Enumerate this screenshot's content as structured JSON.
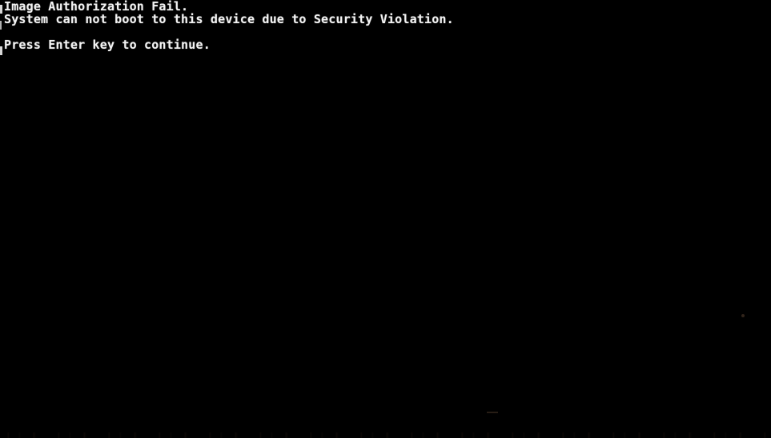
{
  "screen": {
    "background_color": "#000000",
    "text_color": "#f2f2f2",
    "mode": "text-console"
  },
  "console": {
    "lines": [
      {
        "text": "Image Authorization Fail."
      },
      {
        "text": "System can not boot to this device due to Security Violation."
      },
      {
        "text": ""
      },
      {
        "text": "Press Enter key to continue."
      }
    ]
  }
}
